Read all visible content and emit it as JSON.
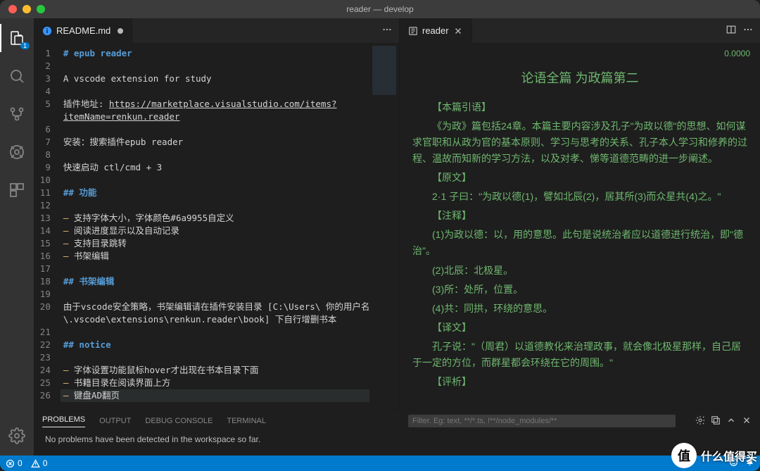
{
  "window": {
    "title": "reader — develop"
  },
  "activity": {
    "badge": "1"
  },
  "leftGroup": {
    "tab": {
      "icon": "info-icon",
      "label": "README.md",
      "dirty": true
    },
    "lines": [
      {
        "n": 1,
        "cls": "tok-h",
        "text": "# epub reader"
      },
      {
        "n": 2,
        "text": ""
      },
      {
        "n": 3,
        "text": "A vscode extension for study"
      },
      {
        "n": 4,
        "text": ""
      },
      {
        "n": 5,
        "html": "插件地址: <span class='tok-link'>https://marketplace.visualstudio.com/items?</span>"
      },
      {
        "n": "",
        "html": "<span class='tok-link'>itemName=renkun.reader</span>"
      },
      {
        "n": 6,
        "text": ""
      },
      {
        "n": 7,
        "text": "安装：搜索插件epub reader"
      },
      {
        "n": 8,
        "text": ""
      },
      {
        "n": 9,
        "text": "快速启动 ctl/cmd + 3"
      },
      {
        "n": 10,
        "text": ""
      },
      {
        "n": 11,
        "cls": "tok-h",
        "text": "## 功能"
      },
      {
        "n": 12,
        "text": ""
      },
      {
        "n": 13,
        "html": "<span class='tok-bullet'>–</span> 支持字体大小，字体颜色#6a9955自定义"
      },
      {
        "n": 14,
        "html": "<span class='tok-bullet'>–</span> 阅读进度显示以及自动记录"
      },
      {
        "n": 15,
        "html": "<span class='tok-bullet'>–</span> 支持目录跳转"
      },
      {
        "n": 16,
        "html": "<span class='tok-bullet'>–</span> 书架编辑"
      },
      {
        "n": 17,
        "text": ""
      },
      {
        "n": 18,
        "cls": "tok-h",
        "text": "## 书架编辑"
      },
      {
        "n": 19,
        "text": ""
      },
      {
        "n": 20,
        "text": "由于vscode安全策略，书架编辑请在插件安装目录 [C:\\Users\\ 你的用户名"
      },
      {
        "n": "",
        "text": "\\.vscode\\extensions\\renkun.reader\\book] 下自行增删书本"
      },
      {
        "n": 21,
        "text": ""
      },
      {
        "n": 22,
        "cls": "tok-h",
        "text": "## notice"
      },
      {
        "n": 23,
        "text": ""
      },
      {
        "n": 24,
        "html": "<span class='tok-bullet'>–</span> 字体设置功能鼠标hover才出现在书本目录下面"
      },
      {
        "n": 25,
        "html": "<span class='tok-bullet'>–</span> 书籍目录在阅读界面上方"
      },
      {
        "n": 26,
        "hl": true,
        "html": "<span class='tok-bullet'>–</span> 键盘AD翻页"
      }
    ]
  },
  "rightGroup": {
    "tab": {
      "label": "reader"
    },
    "progress": "0.0000",
    "title": "论语全篇 为政篇第二",
    "paras": [
      "【本篇引语】",
      "《为政》篇包括24章。本篇主要内容涉及孔子\"为政以德\"的思想、如何谋求官职和从政为官的基本原则、学习与思考的关系、孔子本人学习和修养的过程、温故而知新的学习方法，以及对孝、悌等道德范畴的进一步阐述。",
      "【原文】",
      "2·1 子曰：\"为政以德(1)，譬如北辰(2)，居其所(3)而众星共(4)之。\"",
      "【注释】",
      "(1)为政以德：以，用的意思。此句是说统治者应以道德进行统治，即\"德治\"。",
      "(2)北辰：北极星。",
      "(3)所：处所，位置。",
      "(4)共：同拱，环绕的意思。",
      "【译文】",
      "孔子说：\"（周君）以道德教化来治理政事，就会像北极星那样，自己居于一定的方位，而群星都会环绕在它的周围。\"",
      "【评析】"
    ]
  },
  "panel": {
    "tabs": [
      "PROBLEMS",
      "OUTPUT",
      "DEBUG CONSOLE",
      "TERMINAL"
    ],
    "filterPlaceholder": "Filter. Eg: text, **/*.ts, !**/node_modules/**",
    "message": "No problems have been detected in the workspace so far."
  },
  "status": {
    "errors": "0",
    "warnings": "0"
  },
  "brand": {
    "icon": "值",
    "text": "什么值得买"
  }
}
